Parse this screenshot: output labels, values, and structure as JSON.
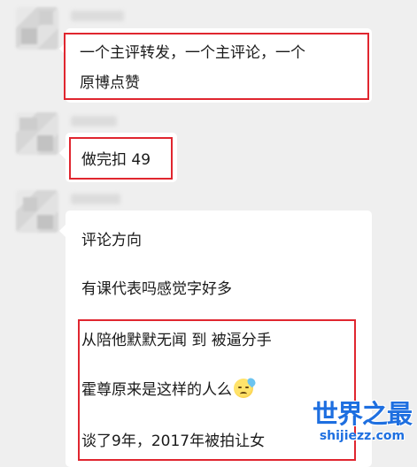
{
  "messages": [
    {
      "lines": [
        "一个主评转发，一个主评论，一个",
        "原博点赞"
      ]
    },
    {
      "lines": [
        "做完扣 49"
      ]
    },
    {
      "lines": [
        "评论方向",
        "有课代表吗感觉字好多",
        "从陪他默默无闻 到 被逼分手",
        "霍尊原来是这样的人么",
        "谈了9年，2017年被拍让女"
      ]
    }
  ],
  "emoji": "sweat-face-icon",
  "watermark": {
    "title": "世界之最",
    "subtitle": "shijiezz.com"
  },
  "colors": {
    "highlight": "#e0262f",
    "background": "#efefef",
    "bubble": "#ffffff",
    "watermark": "#1e6fe0"
  }
}
